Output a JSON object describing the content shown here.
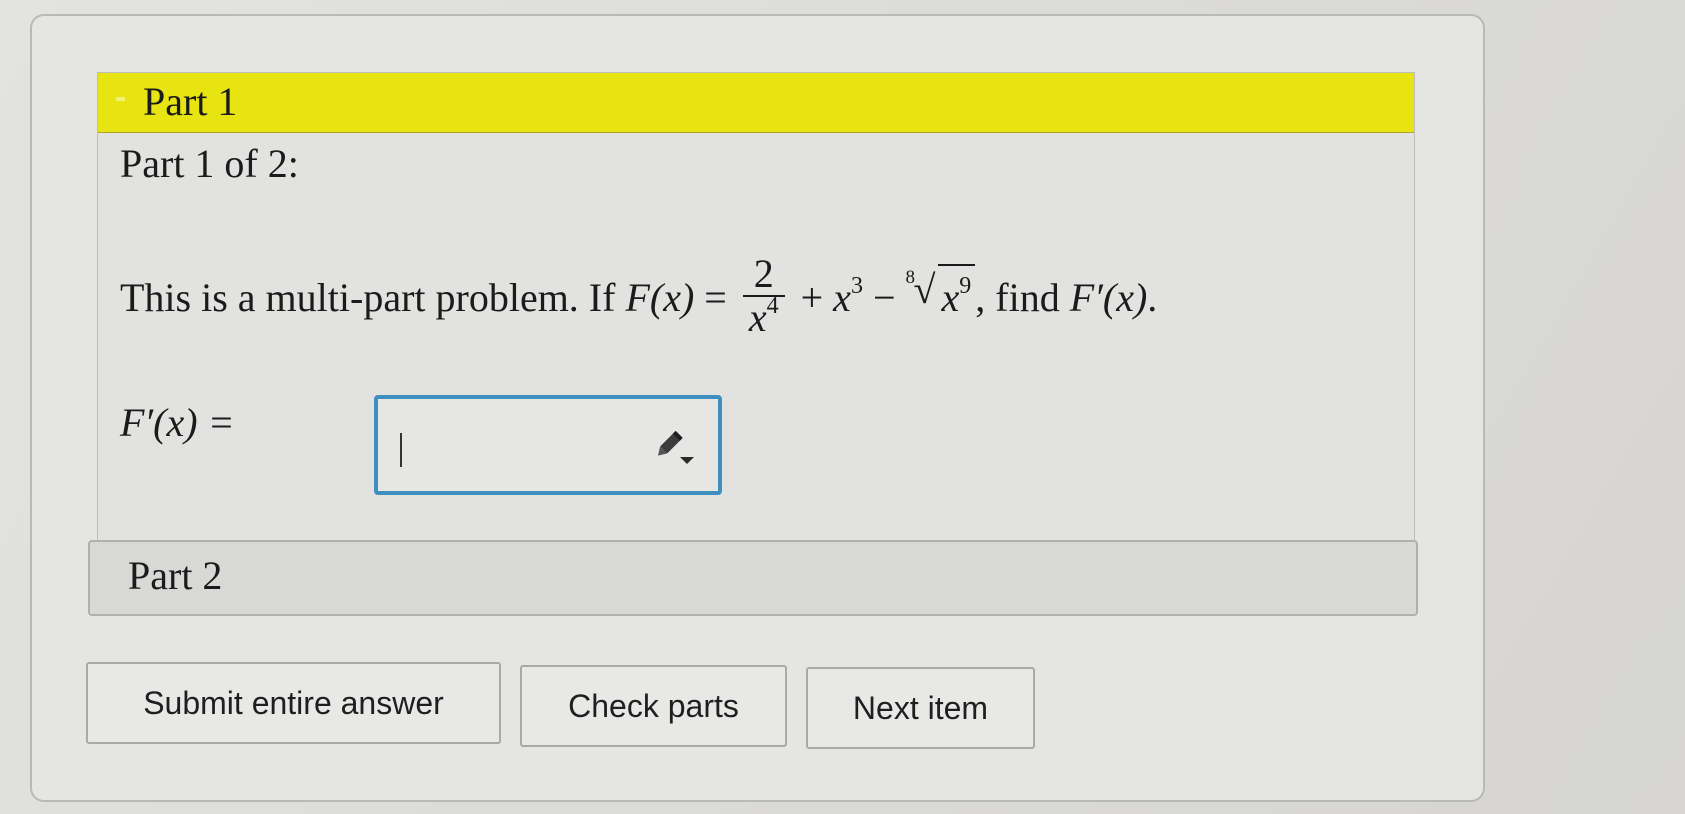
{
  "part1": {
    "title": "Part 1",
    "subheading": "Part 1 of 2:",
    "problem": {
      "intro": "This is a multi-part problem. If ",
      "fx": "F(x)",
      "equals": " = ",
      "frac_num": "2",
      "frac_den": "x",
      "frac_den_exp": "4",
      "plus": " + ",
      "x3_base": "x",
      "x3_exp": "3",
      "minus": " − ",
      "root_index": "8",
      "root_sign": "√",
      "radicand_base": "x",
      "radicand_exp": "9",
      "find": ", find ",
      "fpx": "F′(x)",
      "period": "."
    },
    "answer": {
      "label": "F′(x) =",
      "value": ""
    }
  },
  "part2": {
    "title": "Part 2"
  },
  "buttons": {
    "submit": "Submit entire answer",
    "check": "Check parts",
    "next": "Next item"
  },
  "colors": {
    "part_header": "#e7e412",
    "input_border": "#3f8fc1"
  },
  "icons": {
    "collapse": "collapse-icon",
    "edit": "pencil-dropdown-icon"
  }
}
